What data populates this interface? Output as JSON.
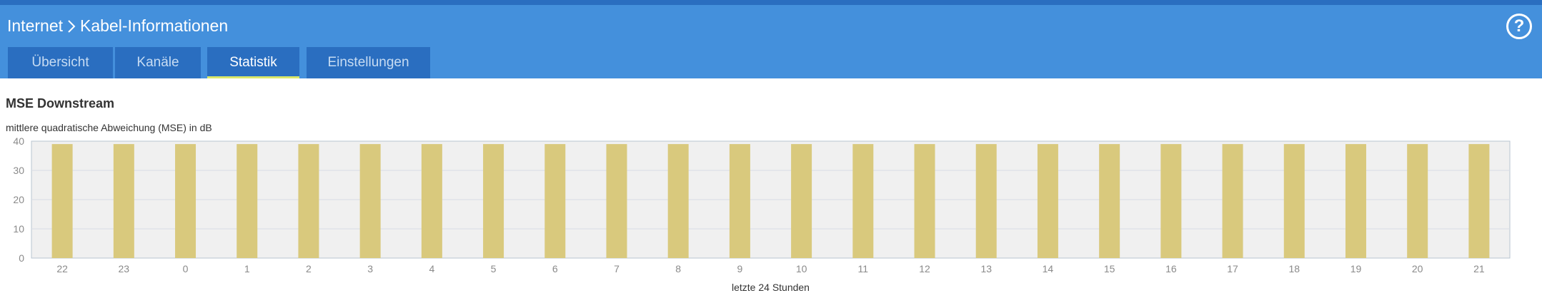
{
  "breadcrumb": {
    "parent": "Internet",
    "current": "Kabel-Informationen"
  },
  "help": {
    "label": "?"
  },
  "tabs": [
    {
      "label": "Übersicht",
      "active": false
    },
    {
      "label": "Kanäle",
      "active": false
    },
    {
      "label": "Statistik",
      "active": true
    },
    {
      "label": "Einstellungen",
      "active": false
    }
  ],
  "section": {
    "title": "MSE Downstream",
    "subtitle": "mittlere quadratische Abweichung (MSE) in dB"
  },
  "colors": {
    "header": "#4490dc",
    "tab": "#2a6ec0",
    "bar": "#d9c97d",
    "plot_bg": "#f0f0f0",
    "active_underline": "#d9e86a"
  },
  "chart_data": {
    "type": "bar",
    "categories": [
      "22",
      "23",
      "0",
      "1",
      "2",
      "3",
      "4",
      "5",
      "6",
      "7",
      "8",
      "9",
      "10",
      "11",
      "12",
      "13",
      "14",
      "15",
      "16",
      "17",
      "18",
      "19",
      "20",
      "21"
    ],
    "series": [
      {
        "values": [
          39,
          39,
          39,
          39,
          39,
          39,
          39,
          39,
          39,
          39,
          39,
          39,
          39,
          39,
          39,
          39,
          39,
          39,
          39,
          39,
          39,
          39,
          39,
          39
        ]
      }
    ],
    "xlabel": "letzte 24 Stunden",
    "ylabel": "",
    "ylim": [
      0,
      40
    ],
    "yticks": [
      0,
      10,
      20,
      30,
      40
    ],
    "grid": true
  }
}
